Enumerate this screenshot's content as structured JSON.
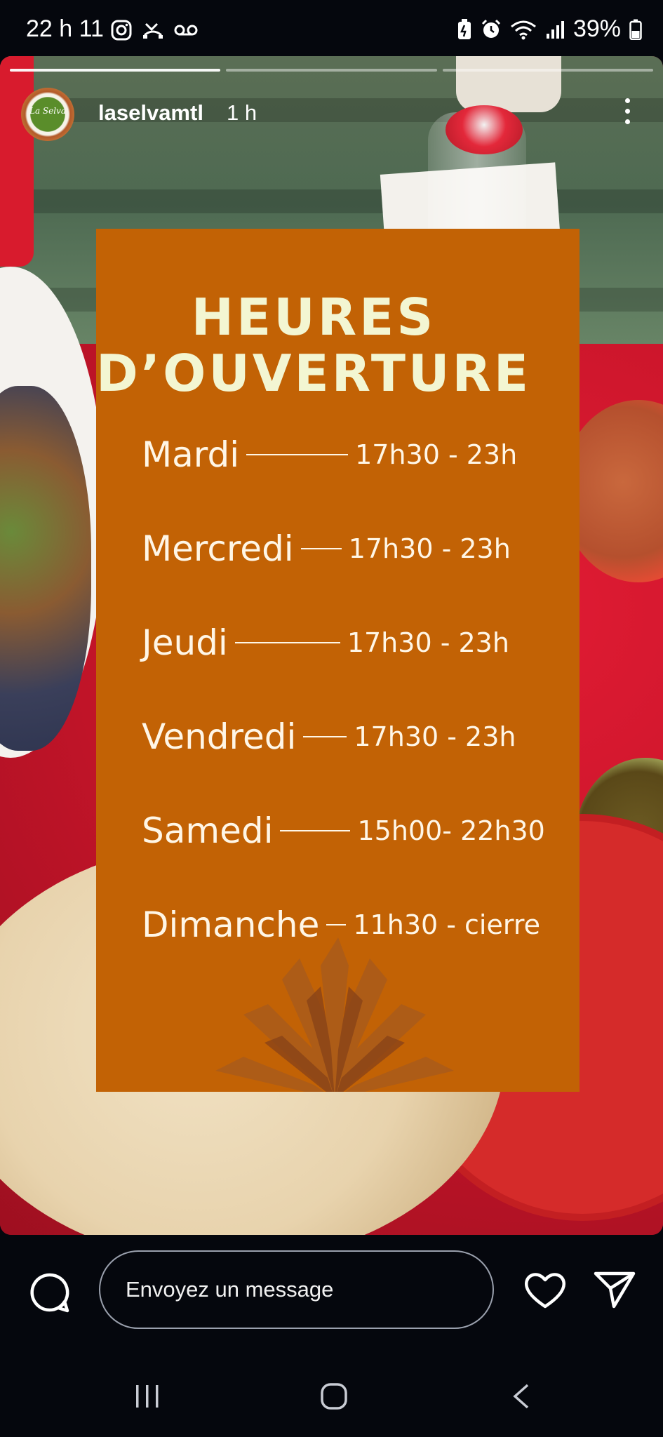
{
  "status_bar": {
    "time": "22 h 11",
    "battery_percent": "39%",
    "left_icons": [
      "instagram-icon",
      "missed-call-icon",
      "voicemail-icon"
    ],
    "right_icons": [
      "battery-saver-icon",
      "alarm-icon",
      "wifi-icon",
      "signal-icon",
      "battery-icon"
    ]
  },
  "story": {
    "progress_segments": 3,
    "progress_done": 1,
    "account": {
      "username": "laselvamtl",
      "time_ago": "1 h",
      "avatar_text": "La Selva"
    }
  },
  "hours_card": {
    "title_line1": "HEURES",
    "title_line2": "D’OUVERTURE",
    "rows": [
      {
        "day": "Mardi",
        "hours": "17h30 - 23h"
      },
      {
        "day": "Mercredi",
        "hours": "17h30 - 23h"
      },
      {
        "day": "Jeudi",
        "hours": "17h30 - 23h"
      },
      {
        "day": "Vendredi",
        "hours": "17h30 - 23h"
      },
      {
        "day": "Samedi",
        "hours": "15h00- 22h30"
      },
      {
        "day": "Dimanche",
        "hours": "11h30 - cierre"
      }
    ],
    "colors": {
      "card": "#c26205",
      "title": "#f3f6d2",
      "text": "#fff6e6"
    }
  },
  "composer": {
    "placeholder": "Envoyez un message"
  },
  "nav": {
    "icons": [
      "recent-apps-icon",
      "home-icon",
      "back-icon"
    ]
  }
}
